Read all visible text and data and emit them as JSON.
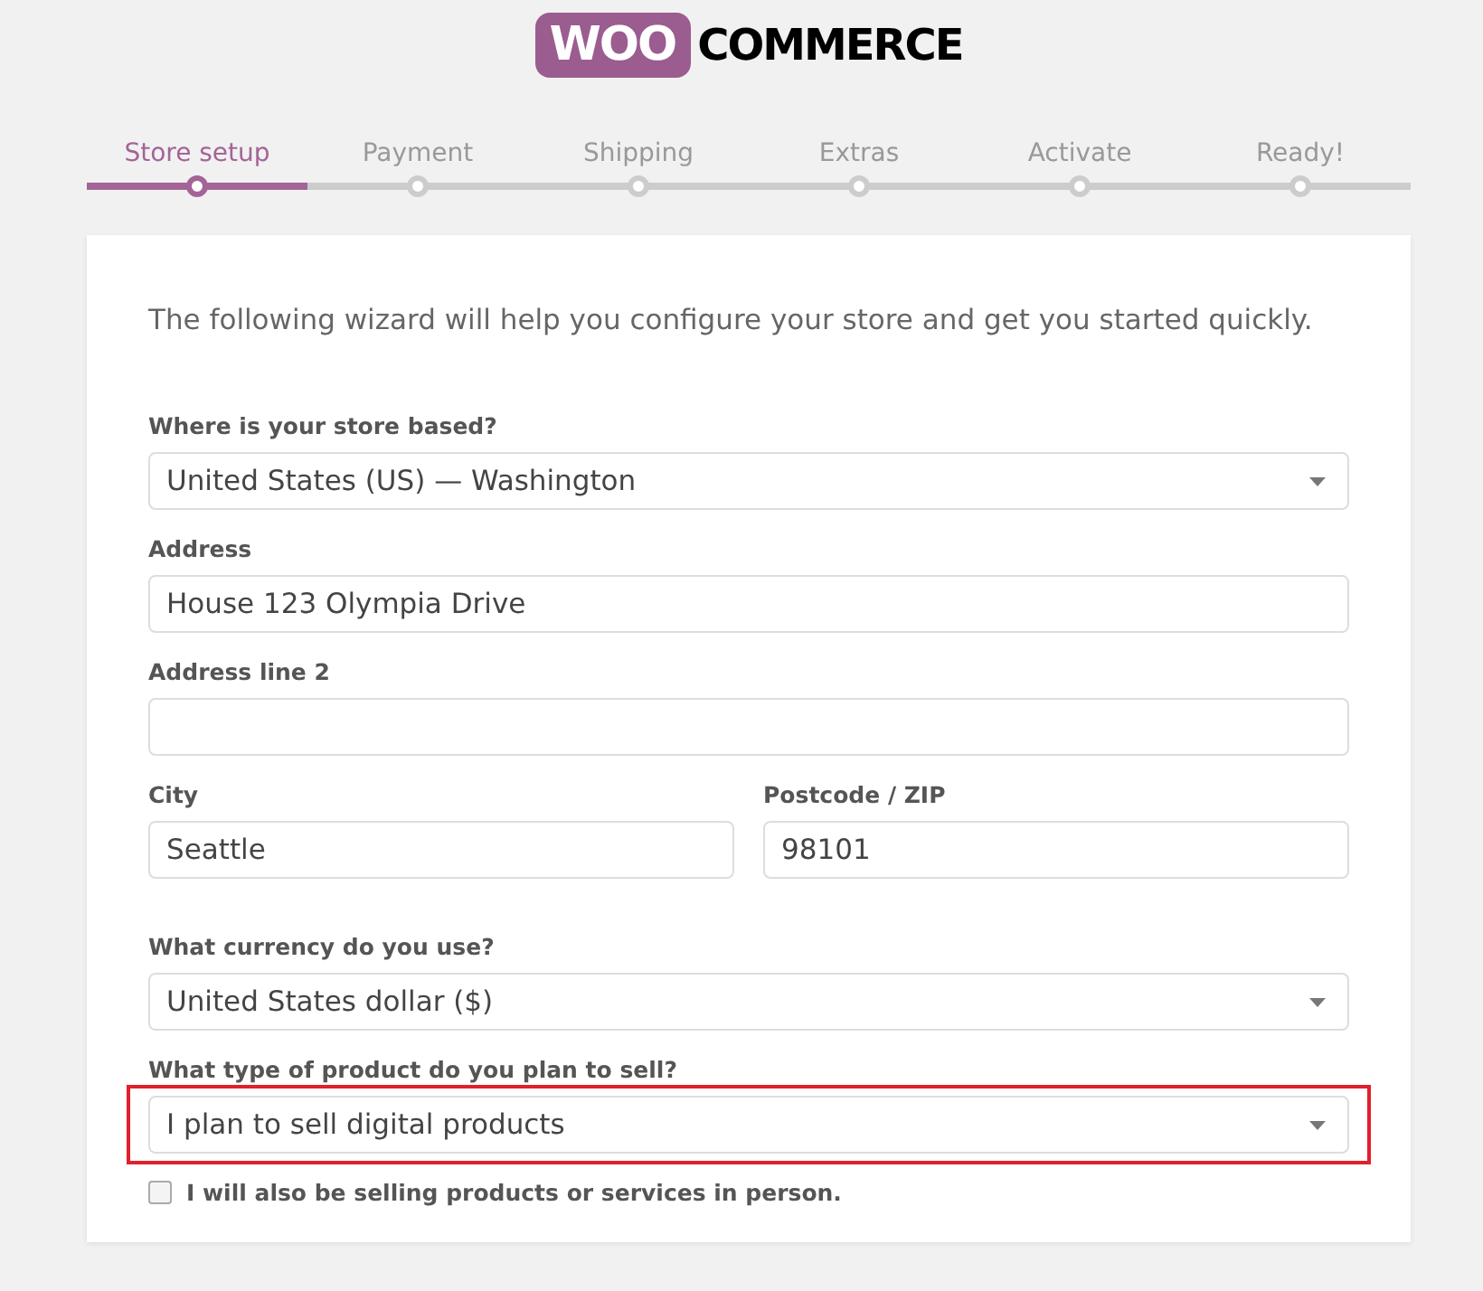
{
  "logo": {
    "badge": "WOO",
    "wordmark": "COMMERCE"
  },
  "steps": [
    {
      "label": "Store setup",
      "selected": true
    },
    {
      "label": "Payment",
      "selected": false
    },
    {
      "label": "Shipping",
      "selected": false
    },
    {
      "label": "Extras",
      "selected": false
    },
    {
      "label": "Activate",
      "selected": false
    },
    {
      "label": "Ready!",
      "selected": false
    }
  ],
  "intro": "The following wizard will help you configure your store and get you started quickly.",
  "rows": [
    {
      "fields": [
        {
          "kind": "select",
          "label": "Where is your store based?",
          "value": "United States (US) — Washington",
          "highlighted": false
        }
      ]
    },
    {
      "fields": [
        {
          "kind": "text",
          "label": "Address",
          "value": "House 123 Olympia Drive",
          "highlighted": false
        }
      ]
    },
    {
      "fields": [
        {
          "kind": "text",
          "label": "Address line 2",
          "highlighted": false
        }
      ]
    },
    {
      "fields": [
        {
          "kind": "text",
          "label": "City",
          "value": "Seattle",
          "highlighted": false
        },
        {
          "kind": "text",
          "label": "Postcode / ZIP",
          "value": "98101",
          "highlighted": false
        }
      ]
    },
    {
      "fields": [
        {
          "kind": "select",
          "label": "What currency do you use?",
          "value": "United States dollar ($)",
          "highlighted": false
        }
      ]
    },
    {
      "fields": [
        {
          "kind": "select",
          "label": "What type of product do you plan to sell?",
          "value": "I plan to sell digital products",
          "highlighted": true
        }
      ]
    }
  ],
  "checkbox": {
    "label": "I will also be selling products or services in person.",
    "checked": false
  }
}
